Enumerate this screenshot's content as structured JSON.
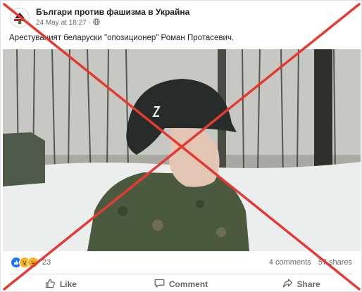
{
  "post": {
    "page_name": "Българи против фашизма в Украйна",
    "timestamp": "24 May at 18:27",
    "separator": "·",
    "privacy_icon": "globe-icon",
    "text": "Арестуваният беларуски \"опозиционер\" Роман Протасевич.",
    "photo_icon": "soldier-photo"
  },
  "stats": {
    "reaction_icons": [
      "like-icon",
      "wow-icon",
      "haha-icon"
    ],
    "reaction_count": "23",
    "comments": "4 comments",
    "shares": "57 shares"
  },
  "actions": {
    "like": "Like",
    "comment": "Comment",
    "share": "Share"
  },
  "colors": {
    "cross": "#e53935",
    "link_gray": "#65676b",
    "like_blue": "#1877f2"
  }
}
